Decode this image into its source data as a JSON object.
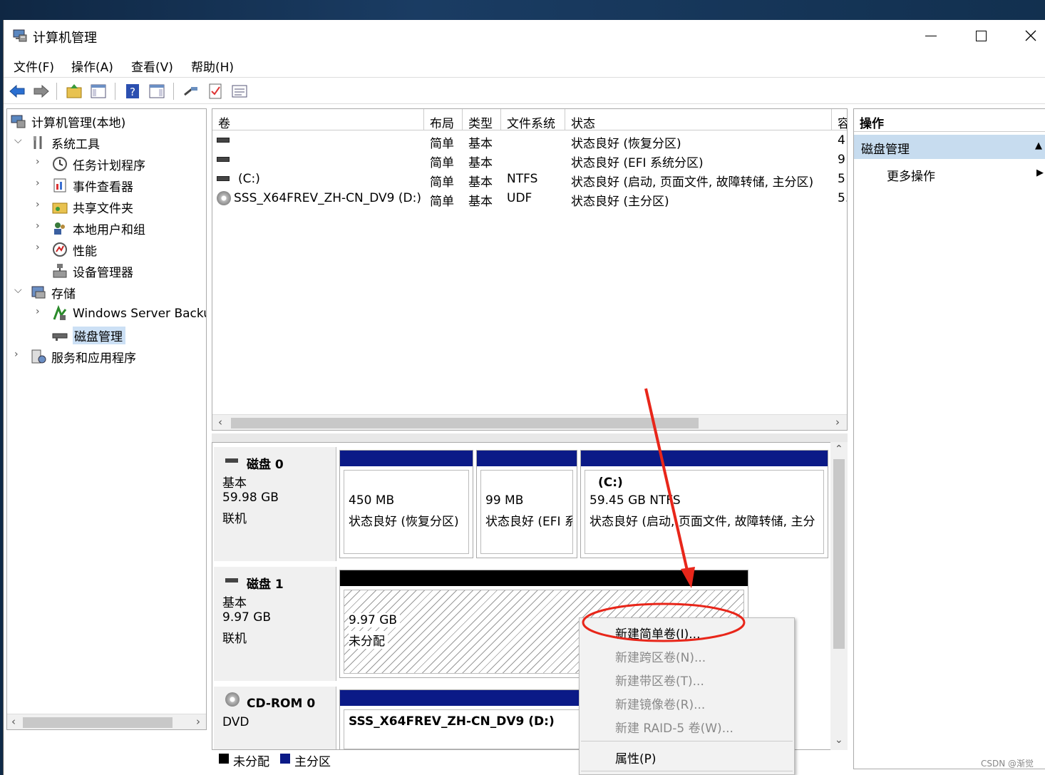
{
  "window": {
    "title": "计算机管理",
    "min": "—",
    "max": "☐",
    "close": "✕"
  },
  "menu": [
    "文件(F)",
    "操作(A)",
    "查看(V)",
    "帮助(H)"
  ],
  "tree": {
    "root": "计算机管理(本地)",
    "system_tools": "系统工具",
    "task_scheduler": "任务计划程序",
    "event_viewer": "事件查看器",
    "shared_folders": "共享文件夹",
    "local_users": "本地用户和组",
    "performance": "性能",
    "device_manager": "设备管理器",
    "storage": "存储",
    "wsb": "Windows Server Backup",
    "disk_mgmt": "磁盘管理",
    "services": "服务和应用程序"
  },
  "volume_list": {
    "columns": [
      "卷",
      "布局",
      "类型",
      "文件系统",
      "状态",
      "容"
    ],
    "rows": [
      {
        "name": "",
        "layout": "简单",
        "type": "基本",
        "fs": "",
        "status": "状态良好 (恢复分区)",
        "cap": "4!"
      },
      {
        "name": "",
        "layout": "简单",
        "type": "基本",
        "fs": "",
        "status": "状态良好 (EFI 系统分区)",
        "cap": "9!"
      },
      {
        "name": "(C:)",
        "layout": "简单",
        "type": "基本",
        "fs": "NTFS",
        "status": "状态良好 (启动, 页面文件, 故障转储, 主分区)",
        "cap": "5!"
      },
      {
        "name": "SSS_X64FREV_ZH-CN_DV9 (D:)",
        "layout": "简单",
        "type": "基本",
        "fs": "UDF",
        "status": "状态良好 (主分区)",
        "cap": "5."
      }
    ]
  },
  "disks": {
    "disk0": {
      "name": "磁盘 0",
      "kind": "基本",
      "size": "59.98 GB",
      "state": "联机",
      "p1_size": "450 MB",
      "p1_status": "状态良好 (恢复分区)",
      "p2_size": "99 MB",
      "p2_status": "状态良好 (EFI 系",
      "p3_name": "(C:)",
      "p3_size": "59.45 GB NTFS",
      "p3_status": "状态良好 (启动, 页面文件, 故障转储, 主分"
    },
    "disk1": {
      "name": "磁盘 1",
      "kind": "基本",
      "size": "9.97 GB",
      "state": "联机",
      "u_size": "9.97 GB",
      "u_label": "未分配"
    },
    "cdrom": {
      "name": "CD-ROM 0",
      "kind": "DVD",
      "vol": "SSS_X64FREV_ZH-CN_DV9 (D:)"
    }
  },
  "legend": {
    "unallocated": "未分配",
    "primary": "主分区"
  },
  "actions": {
    "header": "操作",
    "section": "磁盘管理",
    "more": "更多操作"
  },
  "context_menu": {
    "new_simple": "新建简单卷(I)...",
    "new_spanned": "新建跨区卷(N)...",
    "new_striped": "新建带区卷(T)...",
    "new_mirror": "新建镜像卷(R)...",
    "new_raid5": "新建 RAID-5 卷(W)...",
    "properties": "属性(P)"
  },
  "watermark": "CSDN @渐觉",
  "colors": {
    "primary_partition": "#0b1a87",
    "unallocated": "#000000",
    "annotation": "#e8261a"
  }
}
